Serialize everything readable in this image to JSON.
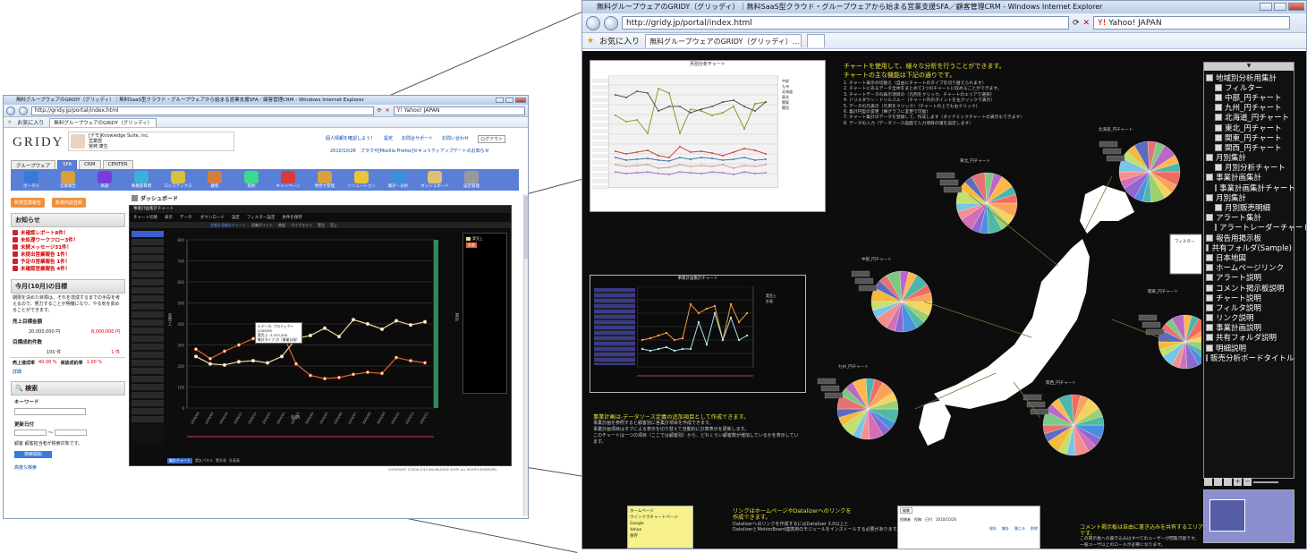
{
  "colors": {
    "accent_blue": "#5a7fd7",
    "line_orange": "#e7612a",
    "line_cream": "#f4d79a",
    "yellow_text": "#e8e23a",
    "dark_bg": "#0d0d0d"
  },
  "left": {
    "title": "無料グループウェアのGRIDY（グリッディ）｜無料SaaS型クラウド・グループウェアから始まる営業支援SFA／顧客管理CRM - Windows Internet Explorer",
    "url": "http://gridy.jp/portal/index.html",
    "search_label": "Yahoo! JAPAN",
    "fav_label": "お気に入り",
    "tab_label": "無料グループウェアのGRIDY（グリッディ）",
    "logo": "GRIDY",
    "user_org": "[デモ]Knowledge Suite, inc.",
    "user_dept": "営業部",
    "user_name": "宮崎 康生",
    "header_links": [
      "個人情報を確認しよう！",
      "設定",
      "お問合サポート",
      "お問い合わせ",
      "ログアウト"
    ],
    "notice": "2010/10/26　ブラウザ[Mozilla Firefox]セキュリティアップデートのお知らせ",
    "nav_tabs": [
      "グループウェア",
      "SFA",
      "CRM",
      "CENTER"
    ],
    "tools": [
      "ポータル",
      "営業報告",
      "商談",
      "事業部目標",
      "ロジスティクス",
      "顧客",
      "契約",
      "キャンペーン",
      "問合せ管理",
      "ソリューション",
      "集計・分析",
      "ダッシュボード",
      "設定管理"
    ],
    "buttons": {
      "report": "新規営業報告",
      "deal": "新規商談登録"
    },
    "notice_title": "お知らせ",
    "notices": [
      "未確認レポート8件！",
      "未処理ワークフロー3件！",
      "未読メッセージ31件！",
      "未提出営業報告 1件！",
      "予定の営業報告 1件！",
      "未確認営業報告 4件！"
    ],
    "goal_title": "今月(10月)の目標",
    "goal_text": "期限を決めた目標は、それを達成するまでの手段を考えるので、努力することが明確になり、やる気を高めることができます。",
    "sales_label": "売上目標金額",
    "sales_goal": "20,000,000 円",
    "sales_actual": "8,000,000 円",
    "count_label": "目標成約件数",
    "count_goal": "100 件",
    "count_actual": "1 件",
    "rate_label1": "売上達成率",
    "rate_val1": "40.00 %",
    "rate_label2": "商談成約率",
    "rate_val2": "1.00 %",
    "details": "詳細",
    "search_title": "検索",
    "keyword": "キーワード",
    "date_label": "更新日付",
    "tilde": "〜",
    "hint": "顧客 顧客担当者が検索対象です。",
    "search_btn": "検索開始",
    "adv": "高度な検索",
    "dashboard_title": "ダッシュボード",
    "chart_title": "事業計画集計チャート",
    "chart_tabs": [
      "チャート切替",
      "表示",
      "データ",
      ".ダウンロード",
      "設定",
      "フィルター設定",
      "条件を保存"
    ],
    "chart_sub": [
      "営業計画集計チャート",
      "収集ポイント",
      "商談",
      "パイプライン",
      "受注",
      "売上"
    ],
    "tooltip": [
      "0:データ: プロジェクト",
      "2009/06",
      "実売上: 3,070,000",
      "集計タイプ:月（事業計画）"
    ],
    "xlabel": "年/月",
    "ylabel_left": "実売上",
    "ylabel_right": "累計",
    "legend": [
      "実売上",
      "計画"
    ],
    "bottom_tabs": [
      "集計チャート",
      "累計パネル",
      "累計表",
      "計画表"
    ],
    "copyright": "COPYRIGHT ©2006-2010 KNOWLEDGE SUITE ALL RIGHTS RESERVED."
  },
  "right": {
    "title": "無料グループウェアのGRIDY（グリッディ）｜無料SaaS型クラウド・グループウェアから始まる営業支援SFA／顧客管理CRM - Windows Internet Explorer",
    "url": "http://gridy.jp/portal/index.html",
    "search_label": "Yahoo! JAPAN",
    "fav_label": "お気に入り",
    "tab_label": "無料グループウェアのGRIDY（グリッディ）...",
    "monthly_title": "月別分析チャート",
    "chart_text_1": "チャートを使用して、様々な分析を行うことができます。",
    "chart_text_2": "チャートの主な機能は下記の通りです。",
    "chart_features": [
      "1. チャート表示の切替え（自由にチャートのタイプを切り替えられます）",
      "2. チャートにあるデータ全体をまとめて1つのチャートに収めることができます。",
      "3. チャートデータの表示項目の（凡例をクリック、チャートのエリアで選択）",
      "4. ドリルダウン・ドリルスルー（チャート内のポイントを左クリックで表示）",
      "5. データの元表示（凡例をクリック）（チャートの上でも右クリック）",
      "6. 集計円型の変更（棒グラフに変更で可能）",
      "7. チャート集計のデータを登録して、作成します（ダイナミックチャートの表示もできます）",
      "8. データの入力（データソース画面で入力項目の値を設定します）"
    ],
    "jikei_title": "事業計画集計チャート",
    "jikei_caption": [
      "事業計画は-データソース定義の追加項目として作成できます。",
      "事業計画を参照すると顧客別に各集計項目を作成できます。",
      "事業計画項目はタブによる表示を切り替えて自動的に計算表示を更新します。",
      "このチャートは一つの項目（ここでは顧客別）から、どれくらい顧客数が増加しているかを表示しています。"
    ],
    "link_caption": [
      "リンクはホームページやDatalizerへのリンクを",
      "作成できます。",
      "Datalizerへのリンクを作成するにはDatalizer 3.0以上と",
      "DatalizerとMotionBoard連携用のモジュールをインストールする必要があります。"
    ],
    "comment_caption": [
      "コメント掲示板は自由に書き込みを共有するエリアです。",
      "この掲示板への書き込みはすべてのユーザーが閲覧可能です。",
      "一般ユーザ以上のロールが必要になります。"
    ],
    "link_items": [
      "ホームページ",
      "ウインドウチャートページ",
      "Google",
      "Yahoo",
      "保存"
    ],
    "comment_box": [
      "編集",
      "投稿者",
      "投稿",
      "日付",
      "2010/10/26",
      "保存",
      "集計",
      "閉じる",
      "削除"
    ],
    "pie_labels": [
      "北海道_円チャート",
      "東北_円チャート",
      "中部_円チャート",
      "関東_円チャート",
      "九州_円チャート",
      "関西_円チャート"
    ],
    "filter_label": "フィルター",
    "tree": [
      "地域別分析用集計",
      "フィルター",
      "中部_円チャート",
      "九州_円チャート",
      "北海道_円チャート",
      "東北_円チャート",
      "関東_円チャート",
      "関西_円チャート",
      "月別集計",
      "月別分析チャート",
      "事業計画集計",
      "事業計画集計チャート",
      "月別集計",
      "月別販売明細",
      "アラート集計",
      "アラートレーダーチャート",
      "報告用掲示板",
      "共有フォルダ(Sample)",
      "日本地図",
      "ホームページリンク",
      "アラート説明",
      "コメント掲示板説明",
      "チャート説明",
      "フィルタ説明",
      "リンク説明",
      "事業計画説明",
      "共有フォルダ説明",
      "明細説明",
      "販売分析ボードタイトル"
    ],
    "monthly_legend": [
      "中部",
      "九州",
      "北海道",
      "東北",
      "関東",
      "関西"
    ]
  },
  "chart_data": [
    {
      "type": "line",
      "title": "事業計画集計チャート",
      "xlabel": "年/月",
      "categories": [
        "2008/08",
        "2008/09",
        "2008/10",
        "2008/11",
        "2008/12",
        "2009/01",
        "2009/02",
        "2009/03",
        "2009/04",
        "2009/05",
        "2009/06",
        "2009/07",
        "2009/08",
        "2009/09",
        "2009/10",
        "2009/11",
        "2009/12"
      ],
      "series": [
        {
          "name": "実売上",
          "values": [
            280,
            235,
            270,
            300,
            330,
            385,
            360,
            210,
            155,
            140,
            145,
            160,
            170,
            165,
            240,
            225,
            215
          ]
        },
        {
          "name": "計画",
          "values": [
            245,
            210,
            205,
            220,
            225,
            215,
            245,
            330,
            345,
            380,
            340,
            420,
            400,
            375,
            415,
            395,
            410
          ]
        }
      ],
      "ylim": [
        0,
        800
      ]
    }
  ]
}
